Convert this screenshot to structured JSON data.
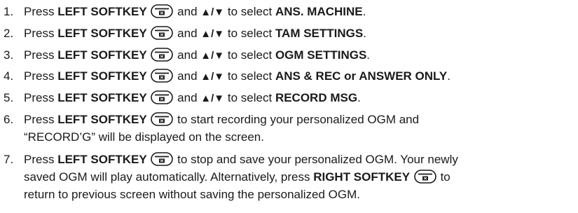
{
  "icons": {
    "softkey": "softkey-icon",
    "up_down_arrows": "▲/▼"
  },
  "steps": [
    {
      "num": "1.",
      "press": "Press",
      "key": "LEFT SOFTKEY",
      "and": "and",
      "arrows": "▲/▼",
      "to_select": "to select",
      "target": "ANS. MACHINE",
      "end": "."
    },
    {
      "num": "2.",
      "press": "Press",
      "key": "LEFT SOFTKEY",
      "and": "and",
      "arrows": "▲/▼",
      "to_select": "to select",
      "target": "TAM SETTINGS",
      "end": "."
    },
    {
      "num": "3.",
      "press": "Press",
      "key": "LEFT SOFTKEY",
      "and": "and",
      "arrows": "▲/▼",
      "to_select": "to select",
      "target": "OGM SETTINGS",
      "end": "."
    },
    {
      "num": "4.",
      "press": "Press",
      "key": "LEFT SOFTKEY",
      "and": "and",
      "arrows": "▲/▼",
      "to_select": "to select",
      "target": "ANS & REC or ANSWER ONLY",
      "end": "."
    },
    {
      "num": "5.",
      "press": "Press",
      "key": "LEFT SOFTKEY",
      "and": "and",
      "arrows": "▲/▼",
      "to_select": "to select",
      "target": "RECORD MSG",
      "end": "."
    },
    {
      "num": "6.",
      "press": "Press",
      "key": "LEFT SOFTKEY",
      "line1_rest": "to start recording your personalized OGM and",
      "line2": "“RECORD’G” will be displayed on the screen."
    },
    {
      "num": "7.",
      "press": "Press",
      "key": "LEFT SOFTKEY",
      "line1_rest": "to stop and save your personalized OGM. Your newly",
      "line2_pre": "saved OGM will play automatically. Alternatively, press",
      "key2": "RIGHT SOFTKEY",
      "line2_post": "to",
      "line3": "return to previous screen without saving the personalized OGM."
    }
  ]
}
